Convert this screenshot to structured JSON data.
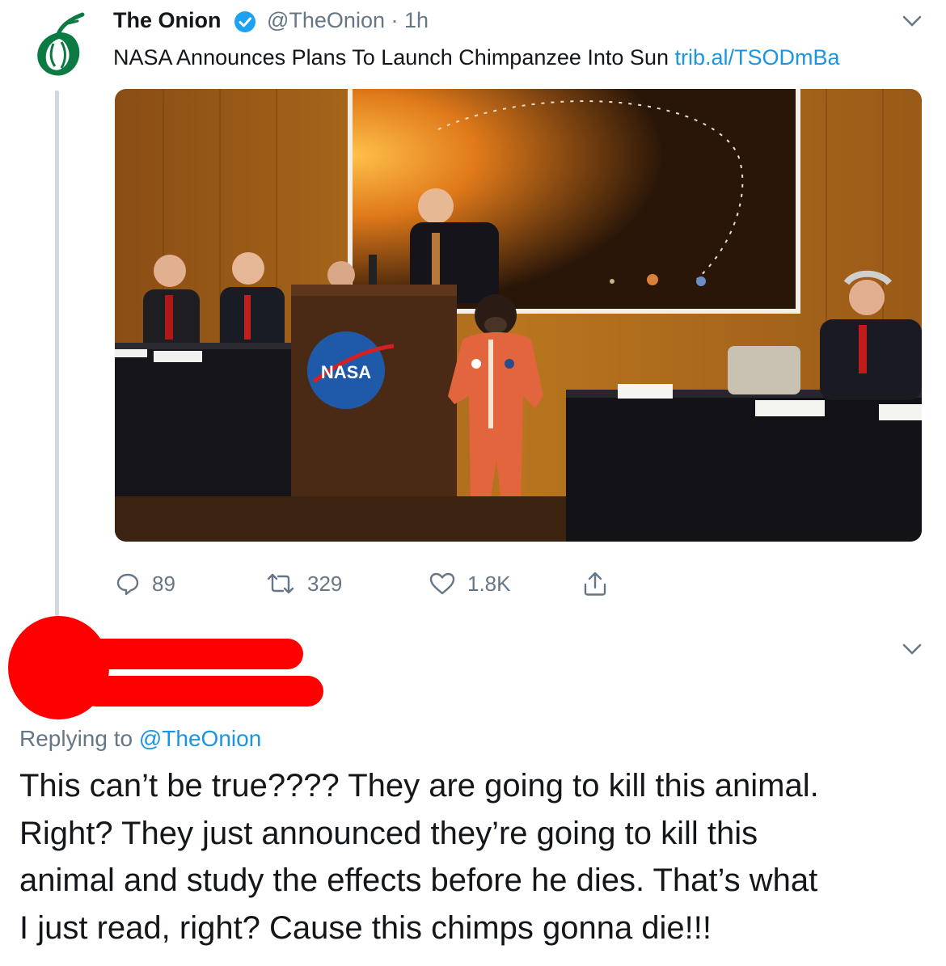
{
  "tweet": {
    "display_name": "The Onion",
    "handle_time": "@TheOnion · 1h",
    "text": "NASA Announces Plans To Launch Chimpanzee Into Sun",
    "link": "trib.al/TSODmBa",
    "image_overlay_text": "NASA",
    "stats": {
      "replies": "89",
      "retweets": "329",
      "likes": "1.8K"
    }
  },
  "reply": {
    "replying_prefix": "Replying to",
    "replying_handle": "@TheOnion",
    "lines": [
      "This can’t be true???? They are going to kill this animal.",
      "Right? They just announced they’re going to kill this",
      "animal and study the effects before he dies. That’s what",
      "I just read, right? Cause this chimps gonna die!!!"
    ]
  },
  "icons": {
    "avatar": "onion-logo-icon",
    "verified": "verified-badge-icon",
    "more": "chevron-down-icon",
    "reply": "reply-icon",
    "retweet": "retweet-icon",
    "like": "heart-icon",
    "share": "share-icon"
  },
  "colors": {
    "onion_green": "#0c7a43",
    "verified_blue": "#1da1f2",
    "link_blue": "#1b95e0",
    "muted_text": "#657786",
    "redaction_red": "#ff0000"
  }
}
